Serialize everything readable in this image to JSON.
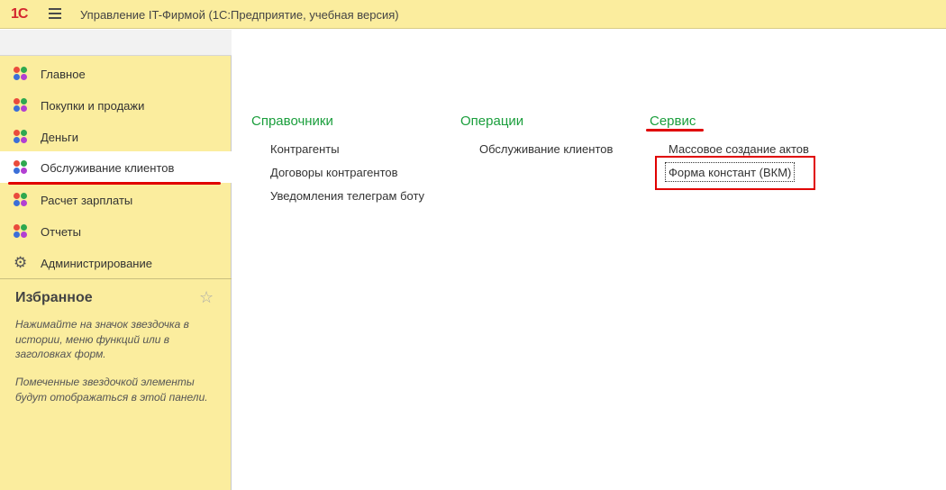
{
  "app": {
    "logo": "1С",
    "title": "Управление IT-Фирмой  (1С:Предприятие, учебная версия)"
  },
  "sidebar": {
    "items": [
      {
        "label": "Главное",
        "icon": "four-dots-icon"
      },
      {
        "label": "Покупки и продажи",
        "icon": "four-dots-icon"
      },
      {
        "label": "Деньги",
        "icon": "four-dots-icon"
      },
      {
        "label": "Обслуживание клиентов",
        "icon": "four-dots-icon",
        "active": true
      },
      {
        "label": "Расчет зарплаты",
        "icon": "four-dots-icon"
      },
      {
        "label": "Отчеты",
        "icon": "four-dots-icon"
      },
      {
        "label": "Администрирование",
        "icon": "gear-icon"
      }
    ],
    "favorites": {
      "title": "Избранное",
      "text1": "Нажимайте на значок звездочка в истории, меню функций или в заголовках форм.",
      "text2": "Помеченные звездочкой элементы будут отображаться в этой панели."
    }
  },
  "main": {
    "columns": [
      {
        "title": "Справочники",
        "links": [
          "Контрагенты",
          "Договоры контрагентов",
          "Уведомления телеграм боту"
        ]
      },
      {
        "title": "Операции",
        "links": [
          "Обслуживание клиентов"
        ]
      },
      {
        "title": "Сервис",
        "links": [
          "Массовое создание актов",
          "Форма констант (ВКМ)"
        ]
      }
    ]
  },
  "colors": {
    "titlebar_bg": "#fbed9e",
    "section_title": "#1a9e3c",
    "annotation_red": "#e00000"
  }
}
